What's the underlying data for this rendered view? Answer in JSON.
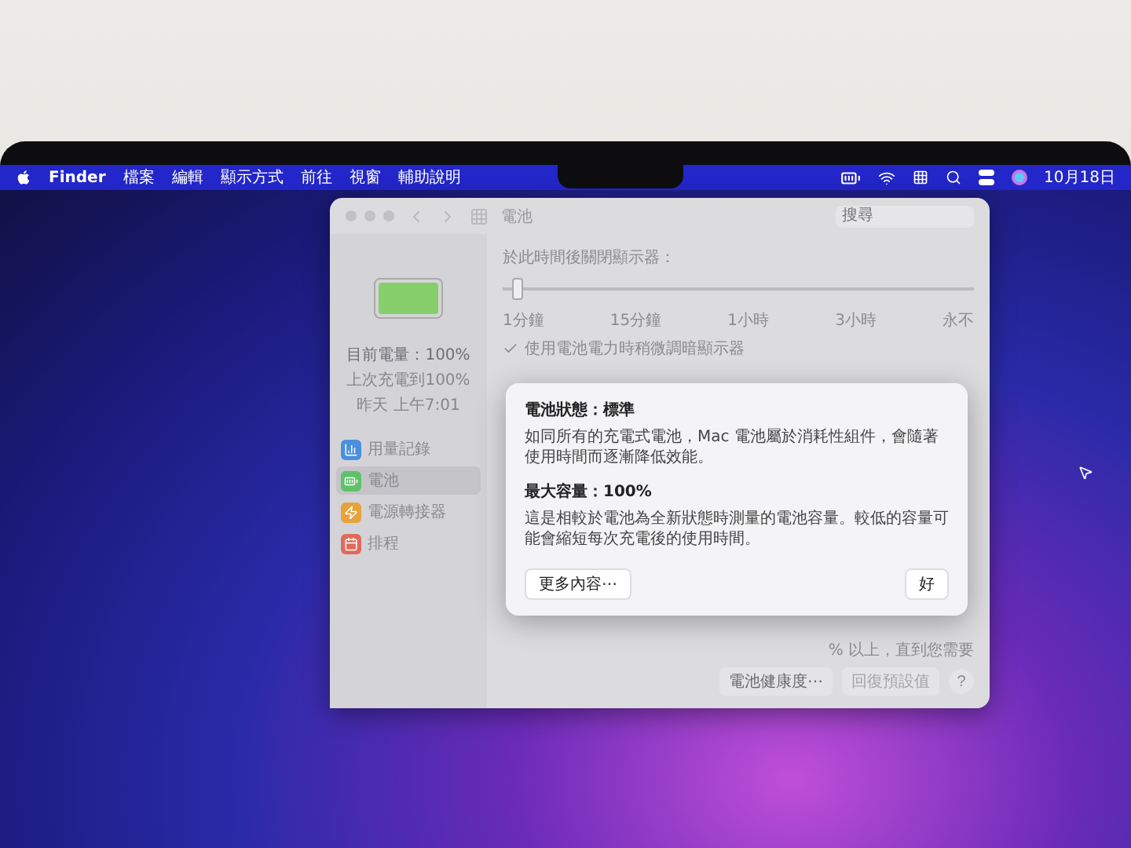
{
  "menu_bar": {
    "app": "Finder",
    "items": [
      "檔案",
      "編輯",
      "顯示方式",
      "前往",
      "視窗",
      "輔助說明"
    ],
    "clock": "10月18日"
  },
  "window": {
    "title": "電池",
    "search": {
      "placeholder": "搜尋"
    },
    "battery": {
      "level": 1,
      "current": "目前電量：100%",
      "last_charge": "上次充電到100%",
      "time": "昨天 上午7:01"
    },
    "sidebar": {
      "items": [
        {
          "label": "用量記錄",
          "selected": false,
          "color": "#4a8fe0"
        },
        {
          "label": "電池",
          "selected": true,
          "color": "#5fc26a"
        },
        {
          "label": "電源轉接器",
          "selected": false,
          "color": "#e8a23a"
        },
        {
          "label": "排程",
          "selected": false,
          "color": "#e06b5a"
        }
      ]
    },
    "display_off": {
      "label": "於此時間後關閉顯示器：",
      "level": 0.03,
      "ticks": [
        "1分鐘",
        "15分鐘",
        "1小時",
        "3小時",
        "永不"
      ]
    },
    "dim_option": {
      "label": "使用電池電力時稍微調暗顯示器",
      "checked": true
    },
    "partial_text": "% 以上，直到您需要",
    "footer": {
      "buttons": [
        {
          "label": "電池健康度⋯",
          "disabled": false
        },
        {
          "label": "回復預設值",
          "disabled": true
        }
      ],
      "help": "?"
    }
  },
  "dialog": {
    "sections": [
      {
        "heading": "電池狀態：標準",
        "body": "如同所有的充電式電池，Mac 電池屬於消耗性組件，會隨著使用時間而逐漸降低效能。"
      },
      {
        "heading": "最大容量：100%",
        "body": "這是相較於電池為全新狀態時測量的電池容量。較低的容量可能會縮短每次充電後的使用時間。"
      }
    ],
    "buttons": [
      "更多內容⋯",
      "好"
    ]
  }
}
